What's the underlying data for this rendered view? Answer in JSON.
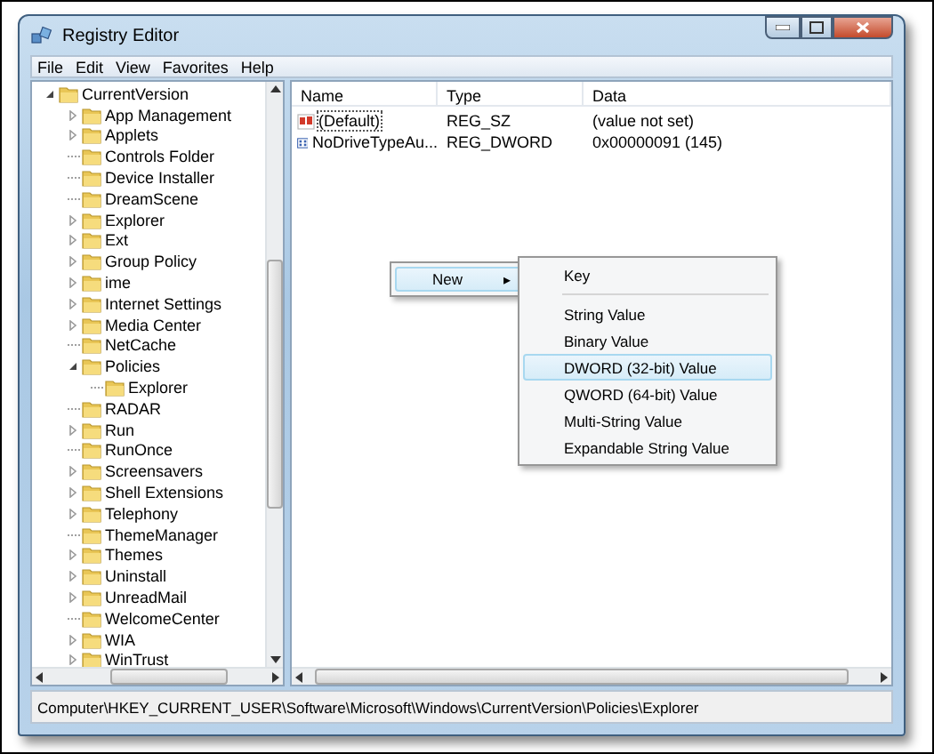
{
  "window": {
    "title": "Registry Editor"
  },
  "menu": [
    {
      "label": "File"
    },
    {
      "label": "Edit"
    },
    {
      "label": "View"
    },
    {
      "label": "Favorites"
    },
    {
      "label": "Help"
    }
  ],
  "tree": [
    {
      "label": "CurrentVersion",
      "kind": "branch",
      "expanded": true,
      "children": [
        {
          "label": "App Management",
          "kind": "branch",
          "expanded": false
        },
        {
          "label": "Applets",
          "kind": "branch",
          "expanded": false
        },
        {
          "label": "Controls Folder",
          "kind": "leaf"
        },
        {
          "label": "Device Installer",
          "kind": "leaf"
        },
        {
          "label": "DreamScene",
          "kind": "leaf"
        },
        {
          "label": "Explorer",
          "kind": "branch",
          "expanded": false
        },
        {
          "label": "Ext",
          "kind": "branch",
          "expanded": false
        },
        {
          "label": "Group Policy",
          "kind": "branch",
          "expanded": false
        },
        {
          "label": "ime",
          "kind": "branch",
          "expanded": false
        },
        {
          "label": "Internet Settings",
          "kind": "branch",
          "expanded": false
        },
        {
          "label": "Media Center",
          "kind": "branch",
          "expanded": false
        },
        {
          "label": "NetCache",
          "kind": "leaf"
        },
        {
          "label": "Policies",
          "kind": "branch",
          "expanded": true,
          "children": [
            {
              "label": "Explorer",
              "kind": "leaf"
            }
          ]
        },
        {
          "label": "RADAR",
          "kind": "leaf"
        },
        {
          "label": "Run",
          "kind": "branch",
          "expanded": false
        },
        {
          "label": "RunOnce",
          "kind": "leaf"
        },
        {
          "label": "Screensavers",
          "kind": "branch",
          "expanded": false
        },
        {
          "label": "Shell Extensions",
          "kind": "branch",
          "expanded": false
        },
        {
          "label": "Telephony",
          "kind": "branch",
          "expanded": false
        },
        {
          "label": "ThemeManager",
          "kind": "leaf"
        },
        {
          "label": "Themes",
          "kind": "branch",
          "expanded": false
        },
        {
          "label": "Uninstall",
          "kind": "branch",
          "expanded": false
        },
        {
          "label": "UnreadMail",
          "kind": "branch",
          "expanded": false
        },
        {
          "label": "WelcomeCenter",
          "kind": "leaf"
        },
        {
          "label": "WIA",
          "kind": "branch",
          "expanded": false
        },
        {
          "label": "WinTrust",
          "kind": "branch",
          "expanded": false
        }
      ]
    }
  ],
  "values": {
    "columns": [
      "Name",
      "Type",
      "Data"
    ],
    "rows": [
      {
        "kind": "string",
        "name": "(Default)",
        "type": "REG_SZ",
        "data": "(value not set)",
        "focused": true
      },
      {
        "kind": "binary",
        "name": "NoDriveTypeAu...",
        "type": "REG_DWORD",
        "data": "0x00000091 (145)",
        "focused": false
      }
    ]
  },
  "context_menu": {
    "items": [
      {
        "label": "New",
        "submenu_arrow": "▸",
        "selected": true
      }
    ],
    "submenu": [
      {
        "kind": "item",
        "label": "Key",
        "selected": false
      },
      {
        "kind": "separator"
      },
      {
        "kind": "item",
        "label": "String Value",
        "selected": false
      },
      {
        "kind": "item",
        "label": "Binary Value",
        "selected": false
      },
      {
        "kind": "item",
        "label": "DWORD (32-bit) Value",
        "selected": true
      },
      {
        "kind": "item",
        "label": "QWORD (64-bit) Value",
        "selected": false
      },
      {
        "kind": "item",
        "label": "Multi-String Value",
        "selected": false
      },
      {
        "kind": "item",
        "label": "Expandable String Value",
        "selected": false
      }
    ]
  },
  "status_bar": "Computer\\HKEY_CURRENT_USER\\Software\\Microsoft\\Windows\\CurrentVersion\\Policies\\Explorer"
}
